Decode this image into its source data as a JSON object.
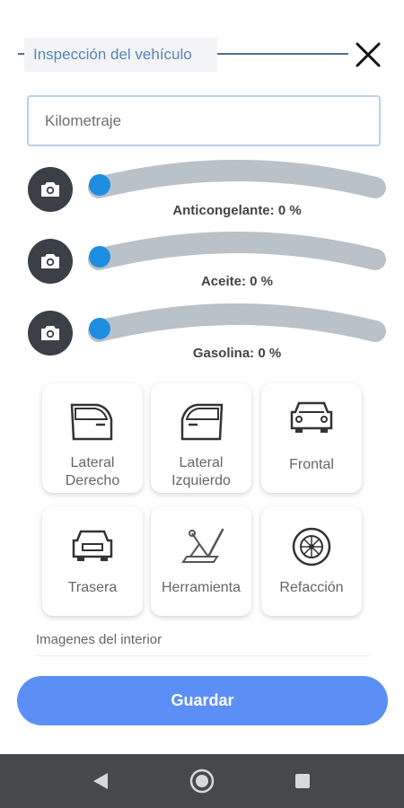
{
  "header": {
    "title": "Inspección del vehículo",
    "close_icon": "close-icon"
  },
  "kilometraje": {
    "placeholder": "Kilometraje",
    "value": ""
  },
  "levels": [
    {
      "label": "Anticongelante: 0 %",
      "value": 0,
      "icon": "camera-icon"
    },
    {
      "label": "Aceite: 0 %",
      "value": 0,
      "icon": "camera-icon"
    },
    {
      "label": "Gasolina: 0 %",
      "value": 0,
      "icon": "camera-icon"
    }
  ],
  "photo_cards": [
    {
      "line1": "Lateral",
      "line2": "Derecho",
      "icon": "car-door-right-icon"
    },
    {
      "line1": "Lateral",
      "line2": "Izquierdo",
      "icon": "car-door-left-icon"
    },
    {
      "line1": "Frontal",
      "icon": "car-front-icon"
    },
    {
      "line1": "Trasera",
      "icon": "car-rear-icon"
    },
    {
      "line1": "Herramienta",
      "icon": "car-jack-icon"
    },
    {
      "line1": "Refacción",
      "icon": "spare-tire-icon"
    }
  ],
  "interior": {
    "label": "Imagenes del interior"
  },
  "save_button": {
    "label": "Guardar"
  },
  "colors": {
    "accent": "#5b8ff5",
    "knob": "#1e8fe0",
    "track": "#b9c1c9",
    "title": "#5a85b8",
    "navbar": "#45494c"
  },
  "navigation": {
    "back_icon": "back-icon",
    "home_icon": "home-icon",
    "recents_icon": "recents-icon"
  }
}
